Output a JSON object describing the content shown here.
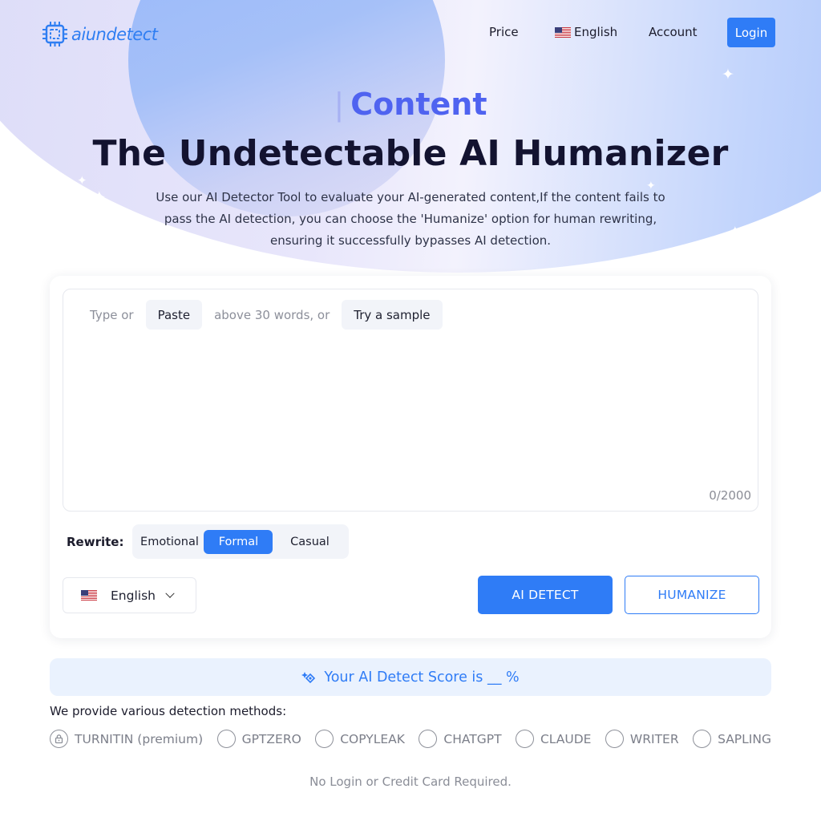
{
  "brand": {
    "name": "aiundetect",
    "accent": "#2f7cf6"
  },
  "nav": {
    "price_label": "Price",
    "language_label": "English",
    "account_label": "Account",
    "login_label": "Login"
  },
  "hero": {
    "kicker": "Content",
    "title": "The Undetectable AI Humanizer",
    "description": "Use our AI Detector Tool to evaluate your AI-generated content,If the content fails to pass the AI detection, you can choose the 'Humanize' option for human rewriting, ensuring it successfully bypasses AI detection."
  },
  "editor": {
    "prefix": "Type or",
    "paste_label": "Paste",
    "middle": "above 30 words, or",
    "sample_label": "Try a sample",
    "word_count": "0/2000"
  },
  "rewrite": {
    "label": "Rewrite:",
    "options": [
      "Emotional",
      "Formal",
      "Casual"
    ],
    "selected": "Formal"
  },
  "language_select": {
    "value": "English"
  },
  "actions": {
    "detect_label": "AI DETECT",
    "humanize_label": "HUMANIZE"
  },
  "score": {
    "text": "Your AI Detect Score is __ %"
  },
  "methods": {
    "title": "We provide various detection methods:",
    "items": [
      "TURNITIN (premium)",
      "GPTZERO",
      "COPYLEAK",
      "CHATGPT",
      "CLAUDE",
      "WRITER",
      "SAPLING"
    ]
  },
  "footer": {
    "note": "No Login or Credit Card Required."
  }
}
